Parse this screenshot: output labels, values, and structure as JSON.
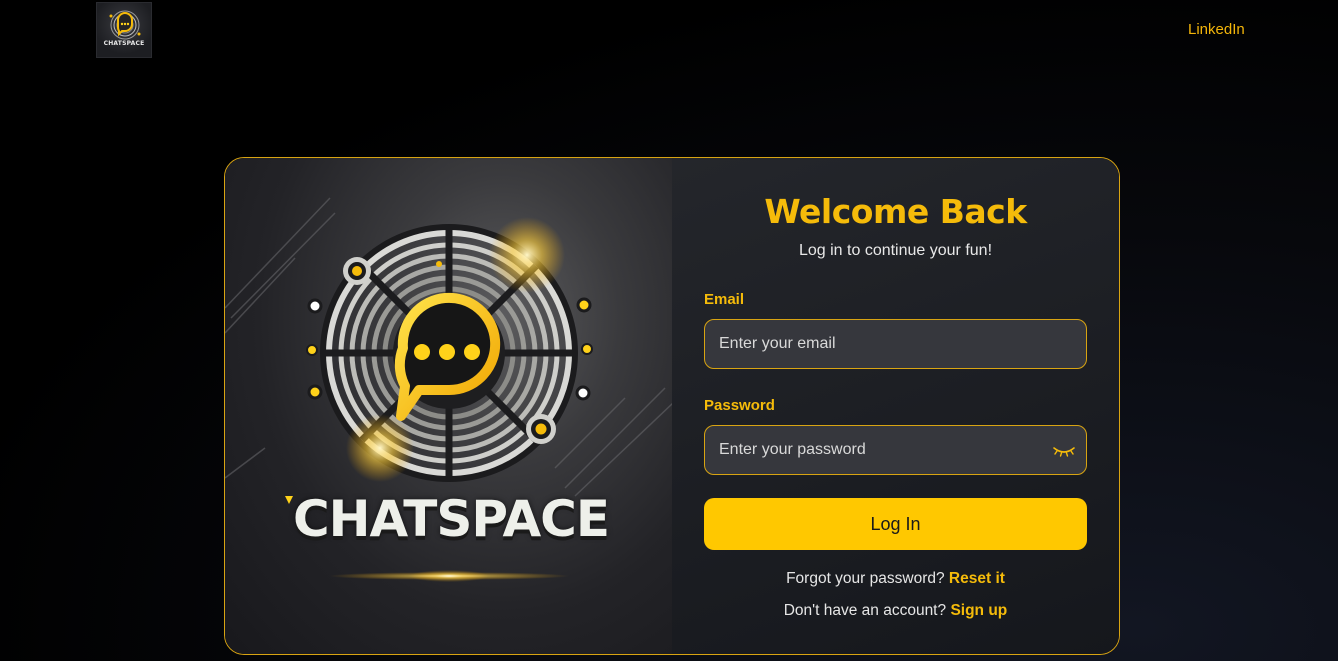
{
  "nav": {
    "logo_text": "CHATSPACE",
    "link_label": "LinkedIn"
  },
  "hero": {
    "brand_text": "CHATSPACE"
  },
  "form": {
    "title": "Welcome Back",
    "subtitle": "Log in to continue your fun!",
    "email_label": "Email",
    "email_placeholder": "Enter your email",
    "password_label": "Password",
    "password_placeholder": "Enter your password",
    "submit_label": "Log In",
    "forgot_text": "Forgot your password?",
    "forgot_link": "Reset it",
    "signup_text": "Don't have an account?",
    "signup_link": "Sign up"
  },
  "colors": {
    "accent": "#f5bb0a",
    "button": "#ffc800",
    "card_border": "#d8a412"
  },
  "icons": [
    "chatspace-logo-icon",
    "eye-closed-icon"
  ]
}
